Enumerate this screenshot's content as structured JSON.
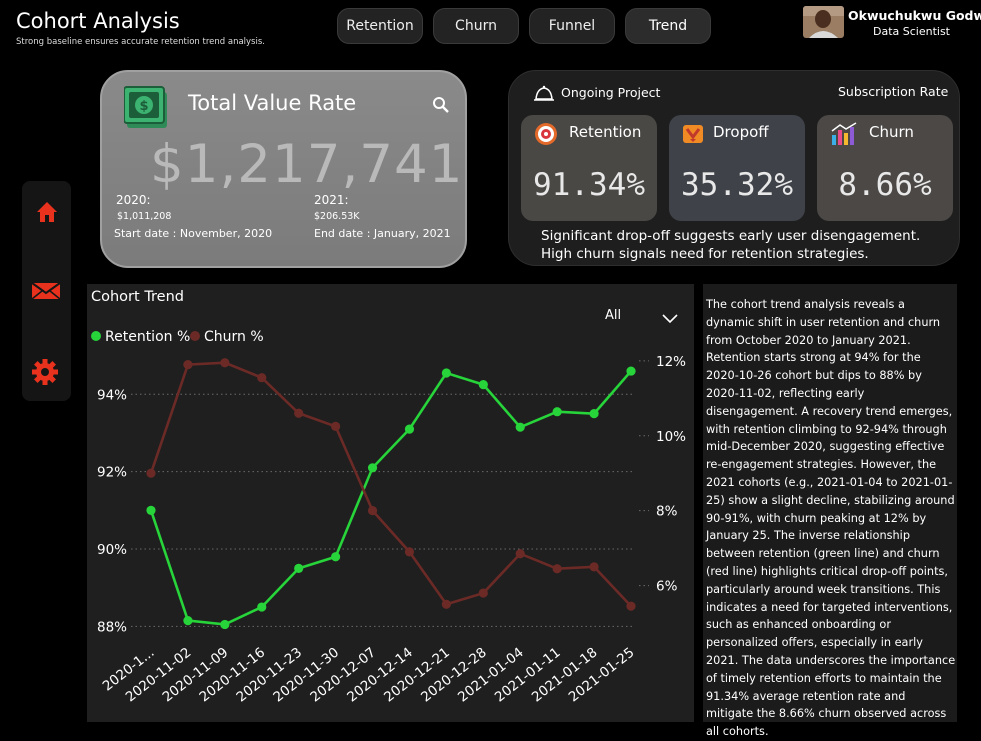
{
  "header": {
    "title": "Cohort Analysis",
    "subtitle": "Strong  baseline ensures accurate retention trend analysis.",
    "tabs": [
      "Retention",
      "Churn",
      "Funnel",
      "Trend"
    ],
    "active_tab": "Trend",
    "user_name": "Okwuchukwu Godwill",
    "user_role": "Data Scientist"
  },
  "sidebar": {
    "icons": [
      "home-icon",
      "mail-icon",
      "gear-icon"
    ],
    "color": "#e8321e"
  },
  "total_value": {
    "title": "Total Value Rate",
    "value": "$1,217,741",
    "year1_label": "2020:",
    "year1_value": "$1,011,208",
    "start": "Start date : November, 2020",
    "year2_label": "2021:",
    "year2_value": "$206.53K",
    "end": "End date : January, 2021"
  },
  "project": {
    "label": "Ongoing Project",
    "subscription": "Subscription Rate",
    "kpis": [
      {
        "label": "Retention",
        "value": "91.34%",
        "bg": "#4a4845"
      },
      {
        "label": "Dropoff",
        "value": "35.32%",
        "bg": "#3f4349"
      },
      {
        "label": "Churn",
        "value": "8.66%",
        "bg": "#4b4846"
      }
    ],
    "note": "Significant drop-off suggests early user disengagement. High churn signals need for retention strategies."
  },
  "chart_panel": {
    "title": "Cohort Trend",
    "filter": "All"
  },
  "chart_data": {
    "type": "line",
    "categories": [
      "2020-1...",
      "2020-11-02",
      "2020-11-09",
      "2020-11-16",
      "2020-11-23",
      "2020-11-30",
      "2020-12-07",
      "2020-12-14",
      "2020-12-21",
      "2020-12-28",
      "2021-01-04",
      "2021-01-11",
      "2021-01-18",
      "2021-01-25"
    ],
    "series": [
      {
        "name": "Retention %",
        "axis": "left",
        "color": "#27d43a",
        "values": [
          91.0,
          88.15,
          88.05,
          88.5,
          89.5,
          89.8,
          92.1,
          93.1,
          94.55,
          94.25,
          93.15,
          93.55,
          93.5,
          94.6
        ]
      },
      {
        "name": "Churn %",
        "axis": "right",
        "color": "#6b2a26",
        "values": [
          9.0,
          11.9,
          11.95,
          11.55,
          10.6,
          10.25,
          8.0,
          6.9,
          5.5,
          5.8,
          6.85,
          6.45,
          6.5,
          5.45
        ]
      }
    ],
    "y_left": {
      "ticks": [
        "88%",
        "90%",
        "92%",
        "94%"
      ],
      "range": [
        87.7,
        95.3
      ]
    },
    "y_right": {
      "ticks": [
        "6%",
        "8%",
        "10%",
        "12%"
      ],
      "range": [
        4.6,
        12.45
      ]
    },
    "legend": "top-left",
    "grid": true
  },
  "analysis_text": "The cohort trend analysis reveals a dynamic shift in user retention and churn from October 2020 to January 2021. Retention starts strong at 94% for the 2020-10-26 cohort but dips to 88% by 2020-11-02, reflecting early disengagement. A recovery trend emerges, with retention climbing to 92-94% through mid-December 2020, suggesting effective re-engagement strategies. However, the 2021 cohorts (e.g., 2021-01-04 to 2021-01-25) show a slight decline, stabilizing around 90-91%, with churn peaking at 12% by January 25. The inverse relationship between retention (green line) and churn (red line) highlights critical drop-off points, particularly around week transitions. This indicates a need for targeted interventions, such as enhanced onboarding or personalized offers, especially in early 2021. The data underscores the importance of timely retention efforts to maintain the 91.34% average retention rate and mitigate the 8.66% churn observed across all cohorts."
}
